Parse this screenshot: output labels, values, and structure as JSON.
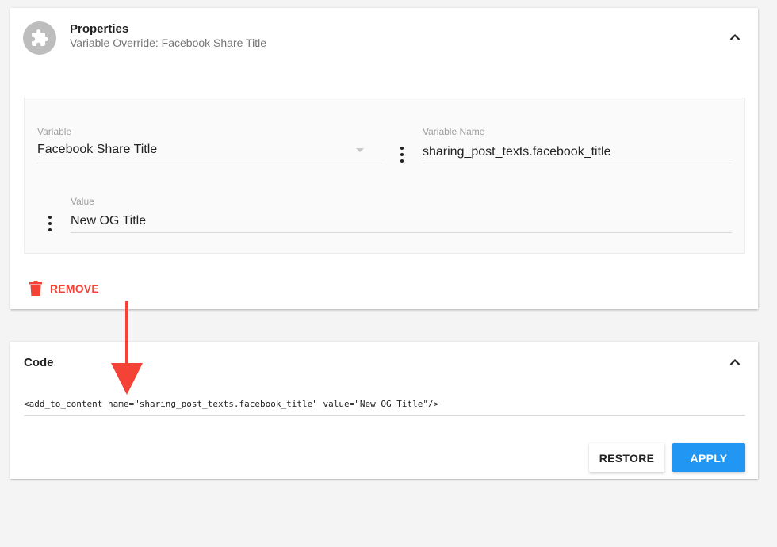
{
  "properties": {
    "title": "Properties",
    "subtitle": "Variable Override: Facebook Share Title",
    "icon": "puzzle-icon",
    "variable": {
      "label": "Variable",
      "value": "Facebook Share Title"
    },
    "variable_name": {
      "label": "Variable Name",
      "value": "sharing_post_texts.facebook_title"
    },
    "value": {
      "label": "Value",
      "value": "New OG Title"
    },
    "remove_label": "REMOVE"
  },
  "code": {
    "title": "Code",
    "content": "<add_to_content name=\"sharing_post_texts.facebook_title\" value=\"New OG Title\"/>",
    "restore_label": "RESTORE",
    "apply_label": "APPLY"
  },
  "colors": {
    "accent": "#2196f3",
    "danger": "#f44336",
    "annotation": "#f44336"
  }
}
